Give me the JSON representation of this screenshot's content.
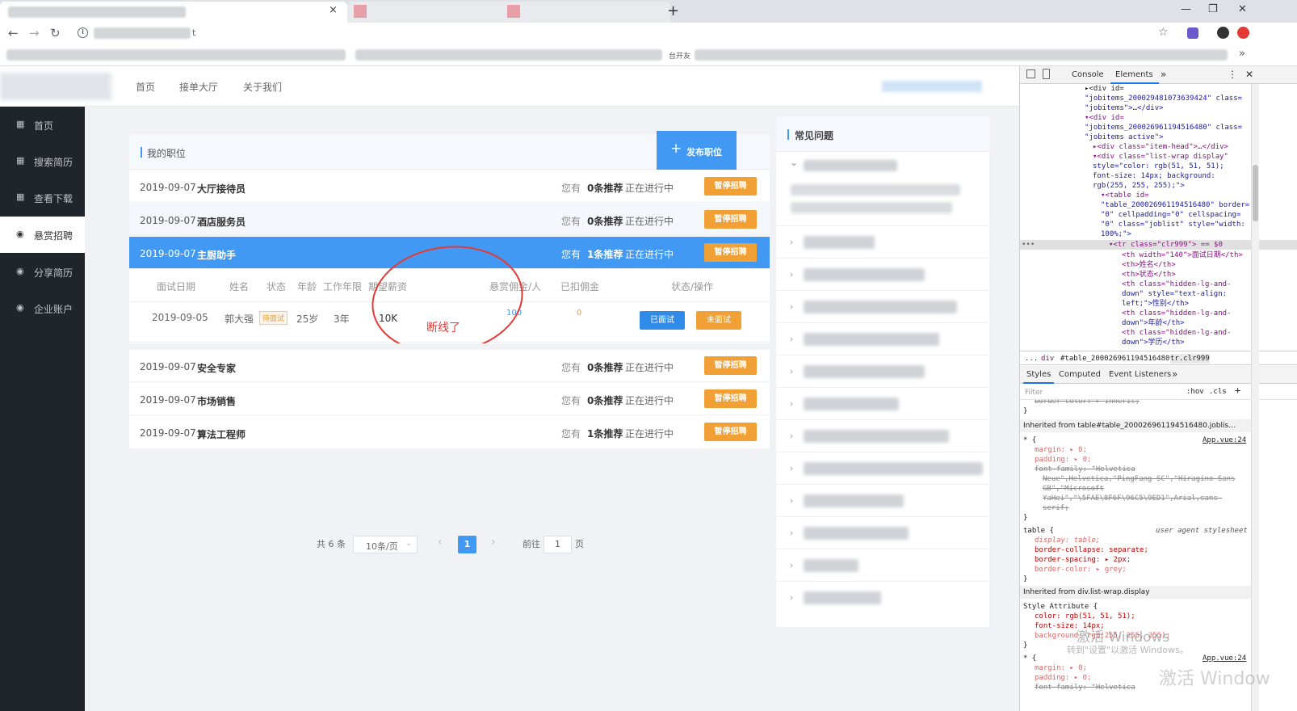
{
  "browser": {
    "close_tab": "×",
    "new_tab": "+",
    "window_controls": [
      "—",
      "❐",
      "✕"
    ],
    "address_fragment": "t",
    "bookmark_fragment": "台开友"
  },
  "header": {
    "nav": [
      "首页",
      "接单大厅",
      "关于我们"
    ]
  },
  "sidebar": {
    "items": [
      {
        "label": "首页",
        "icon": "grid-icon"
      },
      {
        "label": "搜索简历",
        "icon": "grid-icon"
      },
      {
        "label": "查看下载",
        "icon": "grid-icon"
      },
      {
        "label": "悬赏招聘",
        "icon": "target-icon",
        "active": true
      },
      {
        "label": "分享简历",
        "icon": "target-icon"
      },
      {
        "label": "企业账户",
        "icon": "target-icon"
      }
    ]
  },
  "jobs": {
    "section_title": "我的职位",
    "publish_button": "发布职位",
    "rows": [
      {
        "date": "2019-09-07",
        "title": "大厅接待员",
        "you_have": "您有",
        "recommend": "0条推荐",
        "status": "正在进行中",
        "action": "暂停招聘"
      },
      {
        "date": "2019-09-07",
        "title": "酒店服务员",
        "you_have": "您有",
        "recommend": "0条推荐",
        "status": "正在进行中",
        "action": "暂停招聘"
      },
      {
        "date": "2019-09-07",
        "title": "主厨助手",
        "you_have": "您有",
        "recommend": "1条推荐",
        "status": "正在进行中",
        "action": "暂停招聘"
      },
      {
        "date": "2019-09-07",
        "title": "安全专家",
        "you_have": "您有",
        "recommend": "0条推荐",
        "status": "正在进行中",
        "action": "暂停招聘"
      },
      {
        "date": "2019-09-07",
        "title": "市场销售",
        "you_have": "您有",
        "recommend": "0条推荐",
        "status": "正在进行中",
        "action": "暂停招聘"
      },
      {
        "date": "2019-09-07",
        "title": "算法工程师",
        "you_have": "您有",
        "recommend": "1条推荐",
        "status": "正在进行中",
        "action": "暂停招聘"
      }
    ],
    "sub_table": {
      "headers": [
        "面试日期",
        "姓名",
        "状态",
        "年龄",
        "工作年限",
        "期望薪资",
        "悬赏佣金/人",
        "已扣佣金",
        "状态/操作"
      ],
      "row": {
        "date": "2019-09-05",
        "name": "郭大强",
        "status": "待面试",
        "age": "25岁",
        "years": "3年",
        "salary": "10K",
        "reward": "100",
        "deducted": "0",
        "btn_done": "已面试",
        "btn_not": "未面试"
      }
    },
    "annotation": "断线了"
  },
  "pagination": {
    "total": "共 6 条",
    "page_size": "10条/页",
    "prev": "‹",
    "current": "1",
    "next": "›",
    "goto_label": "前往",
    "goto_value": "1",
    "page_unit": "页"
  },
  "faq": {
    "title": "常见问题",
    "chevron_open": "⌄",
    "chevron": "›"
  },
  "devtools": {
    "tabs": [
      "Console",
      "Elements",
      "»"
    ],
    "breadcrumb": [
      "...",
      "div",
      "#table_200026961194516480",
      "tr.clr999"
    ],
    "sub_tabs": [
      "Styles",
      "Computed",
      "Event Listeners",
      "»"
    ],
    "filter_placeholder": "Filter",
    "filter_hov": ":hov",
    "filter_cls": ".cls",
    "dom_lines": [
      "▸<div id=",
      "\"jobitems_200029481073639424\" class=",
      "\"jobitems\">…</div>",
      "▾<div id=",
      "\"jobitems_200026961194516480\" class=",
      "\"jobitems active\">",
      "▸<div class=\"item-head\">…</div>",
      "▾<div class=\"list-wrap display\"",
      "style=\"color: rgb(51, 51, 51);",
      "font-size: 14px; background:",
      "rgb(255, 255, 255);\">",
      "▾<table id=",
      "\"table_200026961194516480\" border=",
      "\"0\" cellpadding=\"0\" cellspacing=",
      "\"0\" class=\"joblist\" style=\"width:",
      "100%;\">",
      "▾<tr class=\"clr999\"> == $0",
      "<th width=\"140\">面试日期</th>",
      "<th>姓名</th>",
      "<th>状态</th>",
      "<th class=\"hidden-lg-and-",
      "down\" style=\"text-align:",
      "left;\">性别</th>",
      "<th class=\"hidden-lg-and-",
      "down\">年龄</th>",
      "<th class=\"hidden-lg-and-",
      "down\">学历</th>"
    ],
    "style_lines": [
      "border-color: ▸ inherit;",
      "}",
      "Inherited from table#table_200026961194516480.joblis…",
      "* {",
      "App.vue:24",
      "margin: ▸ 0;",
      "padding: ▸ 0;",
      "font-family: \"Helvetica",
      "Neue\",Helvetica,\"PingFang SC\",\"Hiragino Sans",
      "GB\",\"Microsoft",
      "YaHei\",\"\\5FAE\\8F6F\\96C5\\9ED1\",Arial,sans-",
      "serif;",
      "}",
      "table {",
      "user agent stylesheet",
      "display: table;",
      "border-collapse: separate;",
      "border-spacing: ▸ 2px;",
      "border-color: ▸ grey;",
      "}",
      "Inherited from div.list-wrap.display",
      "Style Attribute {",
      "color: rgb(51, 51, 51);",
      "font-size: 14px;",
      "background: rgb(255, 255, 255);",
      "}",
      "* {",
      "App.vue:24",
      "margin: ▸ 0;",
      "padding: ▸ 0;",
      "font-family: \"Helvetica"
    ],
    "watermark1": "激活 Windows",
    "watermark2": "转到\"设置\"以激活 Windows。",
    "watermark3": "激活 Window"
  },
  "colors": {
    "accent": "#4199f3",
    "sidebar_bg": "#20242b",
    "orange_button": "#f1a035",
    "annotation_red": "#e53935"
  }
}
